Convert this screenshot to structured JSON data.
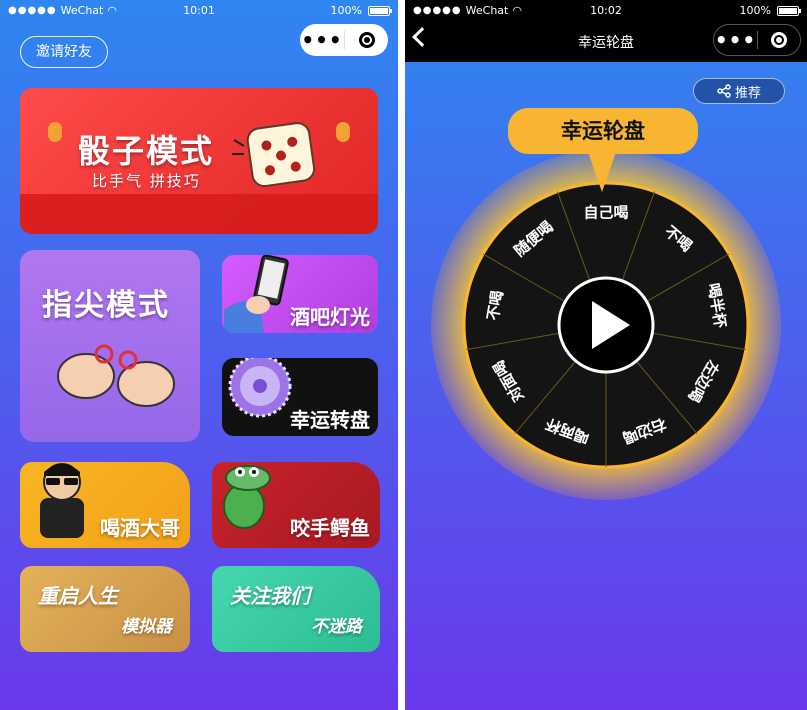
{
  "status_left": {
    "carrier": "WeChat",
    "time": "10:01",
    "battery": "100%"
  },
  "status_right": {
    "carrier": "WeChat",
    "time": "10:02",
    "battery": "100%"
  },
  "left": {
    "invite_label": "邀请好友",
    "cards": {
      "dice": {
        "title": "骰子模式",
        "subtitle": "比手气 拼技巧"
      },
      "fingertip": {
        "title": "指尖模式"
      },
      "bar": {
        "title": "酒吧灯光"
      },
      "turntable": {
        "title": "幸运转盘"
      },
      "drinker": {
        "title": "喝酒大哥"
      },
      "croc": {
        "title": "咬手鳄鱼"
      },
      "life": {
        "title": "重启人生",
        "subtitle": "模拟器"
      },
      "follow": {
        "title": "关注我们",
        "subtitle": "不迷路"
      }
    }
  },
  "right": {
    "nav_title": "幸运轮盘",
    "share_label": "推荐",
    "header_title": "幸运轮盘",
    "wheel_segments": [
      "自己喝",
      "不喝",
      "喝半杯",
      "左边喝",
      "右边喝",
      "喝两杯",
      "对面喝",
      "不喝",
      "随便喝"
    ]
  },
  "colors": {
    "accent": "#f7b531",
    "wheel_bg": "#141414"
  }
}
